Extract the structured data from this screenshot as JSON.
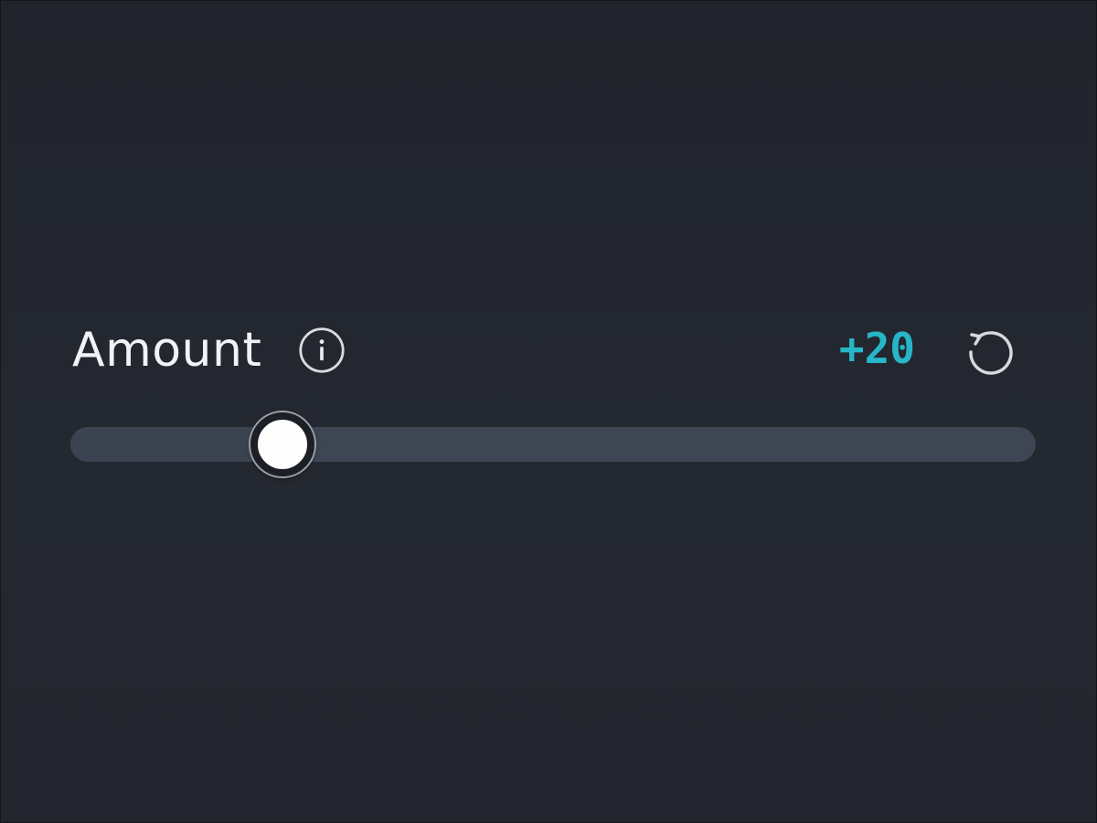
{
  "control": {
    "label": "Amount",
    "value_text": "+20",
    "value": 20,
    "value_fraction": 0.22,
    "accent_color": "#27b6c8"
  },
  "icons": {
    "info": "info-icon",
    "reset": "reset-icon"
  }
}
